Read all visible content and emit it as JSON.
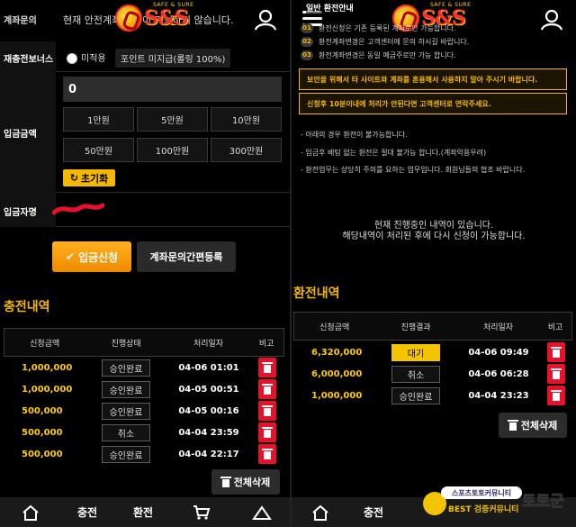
{
  "left": {
    "header": {
      "brand": "S&S",
      "tagline": "SAFE & SURE"
    },
    "ticker_label": "계좌문의",
    "ticker_text": "현재 안전계좌 발행이 가능하지 않습니다.",
    "bonus_row": {
      "label": "재충전보너스",
      "option": "미적용",
      "note": "포인트 미지급(롤링 100%)"
    },
    "amount_row": {
      "label": "입금금액",
      "value": "0",
      "buttons": [
        "1만원",
        "5만원",
        "10만원",
        "50만원",
        "100만원",
        "300만원"
      ],
      "reset_label": "초기화"
    },
    "depositor_row": {
      "label": "입금자명"
    },
    "submit_label": "입금신청",
    "register_label": "계좌문의간편등록",
    "history": {
      "title": "충전내역",
      "columns": [
        "신청금액",
        "진행상태",
        "처리일자",
        "비고"
      ],
      "rows": [
        {
          "amount": "1,000,000",
          "status": "승인완료",
          "date": "04-06 01:01"
        },
        {
          "amount": "1,000,000",
          "status": "승인완료",
          "date": "04-05 00:51"
        },
        {
          "amount": "500,000",
          "status": "승인완료",
          "date": "04-05 00:16"
        },
        {
          "amount": "500,000",
          "status": "취소",
          "date": "04-04 23:59"
        },
        {
          "amount": "500,000",
          "status": "승인완료",
          "date": "04-04 22:17"
        }
      ],
      "delete_all": "전체삭제"
    },
    "nav": {
      "charge": "충전",
      "exchange": "환전"
    }
  },
  "right": {
    "section_label": "일반 환전안내",
    "notices": [
      {
        "num": "01",
        "text": "환전신청은 기존 등록된 계좌로만 가능합니다."
      },
      {
        "num": "02",
        "text": "환전계좌변경은 고객센터에 문의 하시길 바랍니다."
      },
      {
        "num": "03",
        "text": "환전계좌변경은 동일 예금주로만 가능 합니다."
      }
    ],
    "warn1": "보안을 위해서 타 사이트와 계좌를 혼용해서 사용하지 말아 주시기 바랍니다.",
    "warn2": "신청후 10분이내에 처리가 안된다면 고객센터로 연락주세요.",
    "bullets": [
      "- 아래의 경우 환전이 불가능합니다.",
      "- 입금후 배팅 없는 환전은 절대 불가능 합니다.(계좌악용우려)",
      "- 환전업무는 상당히 주의를 요하는 업무입니다. 회원님들의 협조 바랍니다."
    ],
    "progress_msg_1": "현재 진행중인 내역이 있습니다.",
    "progress_msg_2": "해당내역이 처리된 후에 다시 신청이 가능합니다.",
    "history": {
      "title": "환전내역",
      "columns": [
        "신청금액",
        "진행결과",
        "처리일자",
        "비고"
      ],
      "rows": [
        {
          "amount": "6,320,000",
          "status": "대기",
          "date": "04-06 09:49"
        },
        {
          "amount": "6,000,000",
          "status": "취소",
          "date": "04-06 06:28"
        },
        {
          "amount": "1,000,000",
          "status": "승인완료",
          "date": "04-04 23:23"
        }
      ],
      "delete_all": "전체삭제"
    },
    "nav": {
      "charge": "충전"
    },
    "watermark": {
      "bubble": "스포츠토토커뮤니티",
      "best": "BEST 검증커뮤니티",
      "big": "토토군"
    }
  },
  "colors": {
    "accent": "#f5b800",
    "danger": "#e8102a",
    "pending": "#f5c400"
  }
}
